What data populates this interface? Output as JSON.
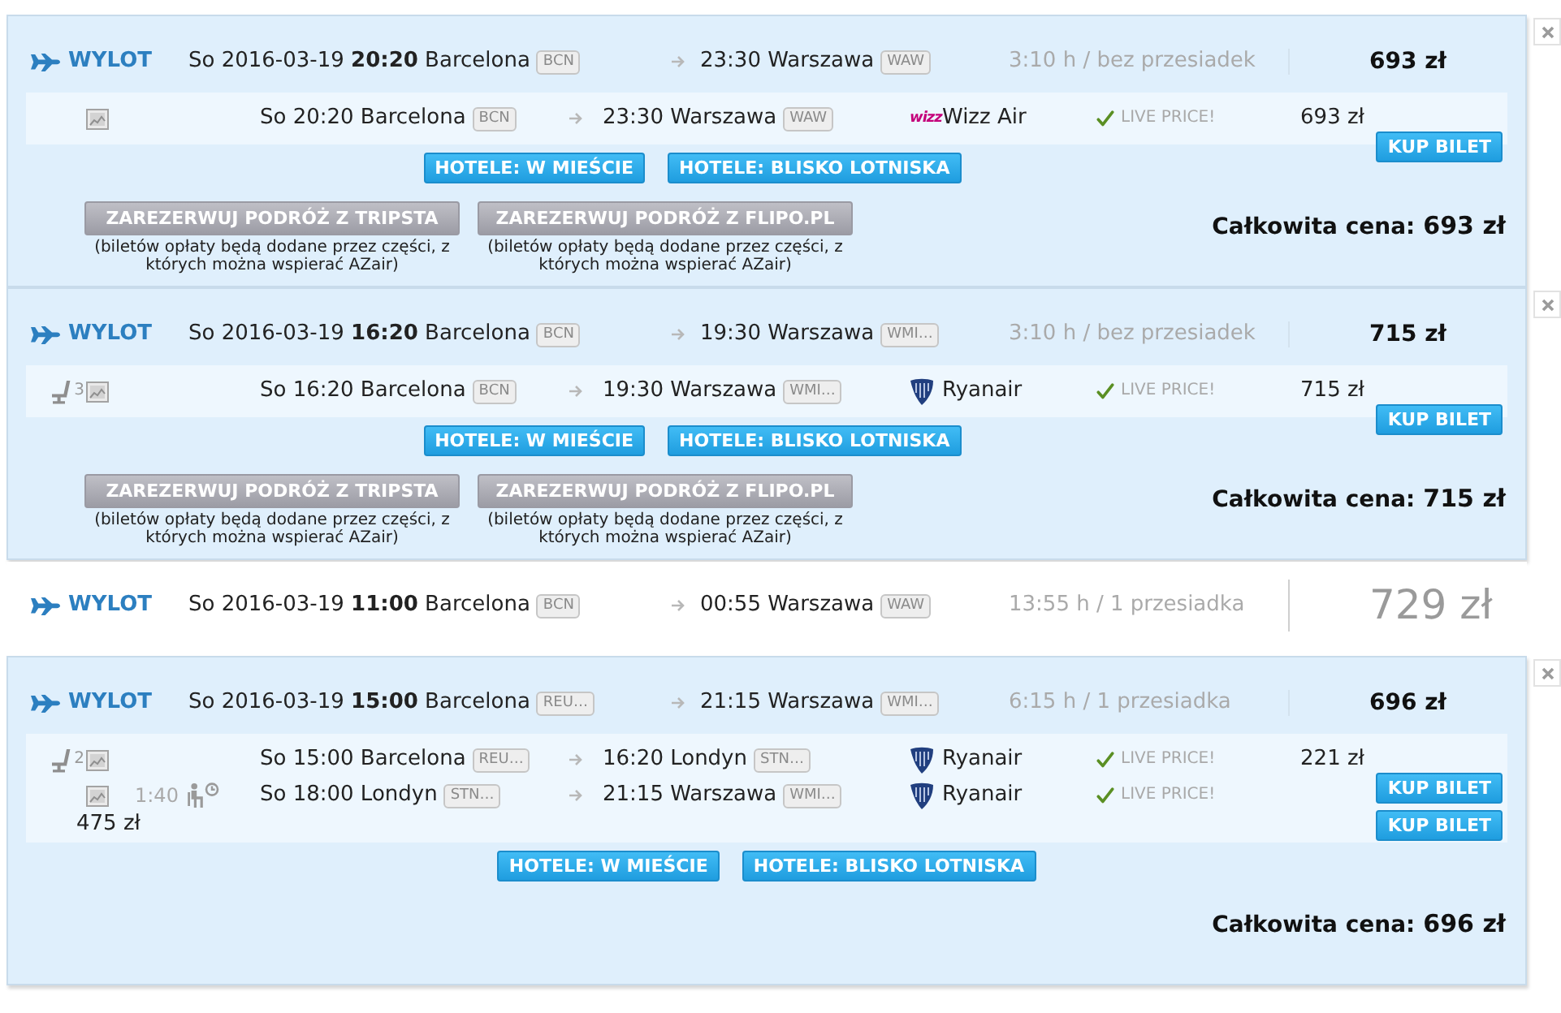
{
  "results": [
    {
      "kind": "expanded",
      "label": "WYLOT",
      "departure": "So 2016-03-19 **20:20** Barcelona",
      "origin_code": "BCN",
      "arrival": "23:30 Warszawa",
      "destination_code": "WAW",
      "duration": "3:10 h / bez przesiadek",
      "price": "693 zł",
      "segments": [
        {
          "kind": "leg",
          "departure": "So 20:20 Barcelona",
          "origin_code": "BCN",
          "arrival": "23:30 Warszawa",
          "destination_code": "WAW",
          "logo": {
            "kind": "wordmark",
            "text": "wizz"
          },
          "airline": "Wizz Air",
          "live_price": "LIVE PRICE!",
          "price": "693 zł",
          "buy_button": "KUP BILET"
        }
      ],
      "hotel_buttons": [
        "HOTELE: W MIEŚCIE",
        "HOTELE: BLISKO LOTNISKA"
      ],
      "booking_options": [
        {
          "button": "ZAREZERWUJ PODRÓŻ Z TRIPSTA",
          "note": "(biletów opłaty będą dodane przez części, z których można wspierać AZair)"
        },
        {
          "button": "ZAREZERWUJ PODRÓŻ Z FLIPO.PL",
          "note": "(biletów opłaty będą dodane przez części, z których można wspierać AZair)"
        }
      ],
      "total_label": "Całkowita cena:",
      "total_price": "693 zł"
    },
    {
      "kind": "expanded",
      "label": "WYLOT",
      "departure": "So 2016-03-19 **16:20** Barcelona",
      "origin_code": "BCN",
      "arrival": "19:30 Warszawa",
      "destination_code": "WMI…",
      "duration": "3:10 h / bez przesiadek",
      "price": "715 zł",
      "segments": [
        {
          "kind": "leg",
          "seats_left": "3",
          "departure": "So 16:20 Barcelona",
          "origin_code": "BCN",
          "arrival": "19:30 Warszawa",
          "destination_code": "WMI…",
          "logo": {
            "kind": "harp"
          },
          "airline": "Ryanair",
          "live_price": "LIVE PRICE!",
          "price": "715 zł",
          "buy_button": "KUP BILET"
        }
      ],
      "hotel_buttons": [
        "HOTELE: W MIEŚCIE",
        "HOTELE: BLISKO LOTNISKA"
      ],
      "booking_options": [
        {
          "button": "ZAREZERWUJ PODRÓŻ Z TRIPSTA",
          "note": "(biletów opłaty będą dodane przez części, z których można wspierać AZair)"
        },
        {
          "button": "ZAREZERWUJ PODRÓŻ Z FLIPO.PL",
          "note": "(biletów opłaty będą dodane przez części, z których można wspierać AZair)"
        }
      ],
      "total_label": "Całkowita cena:",
      "total_price": "715 zł"
    },
    {
      "kind": "collapsed",
      "label": "WYLOT",
      "departure": "So 2016-03-19 **11:00** Barcelona",
      "origin_code": "BCN",
      "arrival": "00:55 Warszawa",
      "destination_code": "WAW",
      "duration": "13:55 h / 1 przesiadka",
      "price": "729 zł"
    },
    {
      "kind": "expanded",
      "label": "WYLOT",
      "departure": "So 2016-03-19 **15:00** Barcelona",
      "origin_code": "REU…",
      "arrival": "21:15 Warszawa",
      "destination_code": "WMI…",
      "duration": "6:15 h / 1 przesiadka",
      "price": "696 zł",
      "segments": [
        {
          "kind": "leg",
          "seats_left": "2",
          "departure": "So 15:00 Barcelona",
          "origin_code": "REU…",
          "arrival": "16:20 Londyn",
          "destination_code": "STN…",
          "logo": {
            "kind": "harp"
          },
          "airline": "Ryanair",
          "live_price": "LIVE PRICE!",
          "price": "221 zł",
          "buy_button": "KUP BILET"
        },
        {
          "kind": "connecting",
          "layover": "1:40",
          "departure": "So 18:00 Londyn",
          "origin_code": "STN…",
          "arrival": "21:15 Warszawa",
          "destination_code": "WMI…",
          "logo": {
            "kind": "harp"
          },
          "airline": "Ryanair",
          "live_price": "LIVE PRICE!",
          "price": "475 zł",
          "buy_button": "KUP BILET"
        }
      ],
      "hotel_buttons": [
        "HOTELE: W MIEŚCIE",
        "HOTELE: BLISKO LOTNISKA"
      ],
      "total_label": "Całkowita cena:",
      "total_price": "696 zł"
    }
  ]
}
